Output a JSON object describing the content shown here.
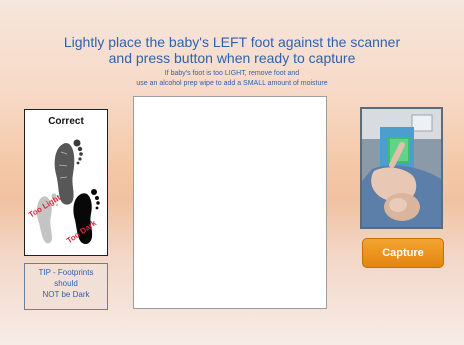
{
  "instructions": {
    "title_line1": "Lightly place the baby's LEFT foot against the scanner",
    "title_line2": "and press button when ready to capture",
    "subtitle_line1": "If baby's foot is too LIGHT, remove foot and",
    "subtitle_line2": "use an alcohol prep wipe to add a SMALL amount of moisture"
  },
  "example_card": {
    "correct_label": "Correct",
    "too_light_label": "Too Light",
    "too_dark_label": "Too Dark"
  },
  "tip": {
    "line1": "TIP - Footprints",
    "line2": "should",
    "line3": "NOT be Dark"
  },
  "capture_button": {
    "label": "Capture"
  },
  "colors": {
    "accent_blue": "#2f62ad",
    "capture_orange": "#ec9620",
    "warning_red": "#d9293a"
  }
}
